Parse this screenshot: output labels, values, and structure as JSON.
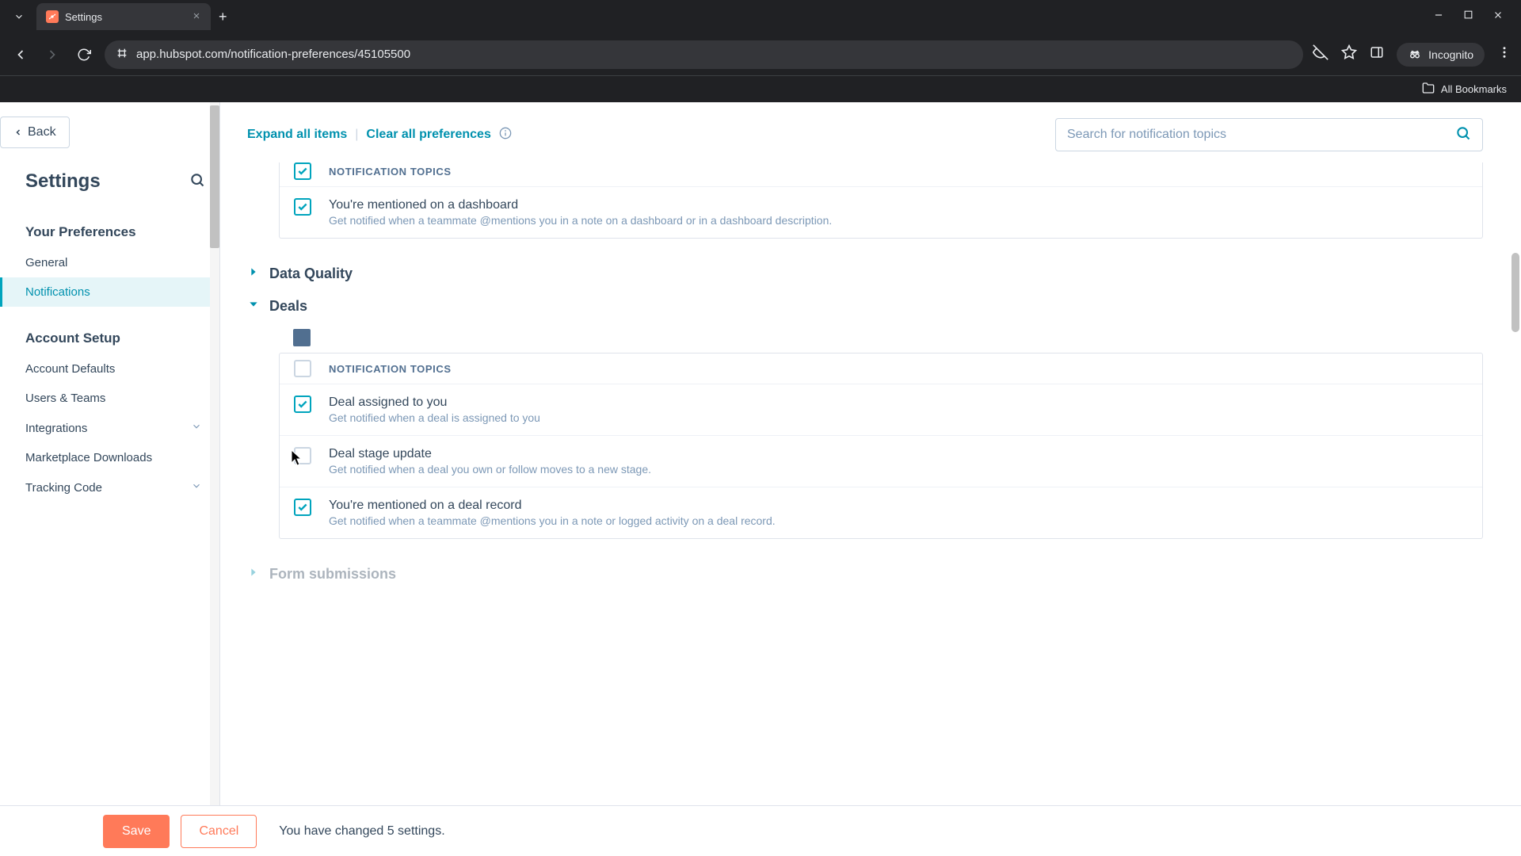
{
  "browser": {
    "tab_title": "Settings",
    "url": "app.hubspot.com/notification-preferences/45105500",
    "incognito_label": "Incognito",
    "bookmarks_label": "All Bookmarks"
  },
  "sidebar": {
    "back_label": "Back",
    "title": "Settings",
    "sections": [
      {
        "heading": "Your Preferences",
        "items": [
          {
            "label": "General",
            "active": false
          },
          {
            "label": "Notifications",
            "active": true
          }
        ]
      },
      {
        "heading": "Account Setup",
        "items": [
          {
            "label": "Account Defaults"
          },
          {
            "label": "Users & Teams"
          },
          {
            "label": "Integrations",
            "expandable": true
          },
          {
            "label": "Marketplace Downloads"
          },
          {
            "label": "Tracking Code",
            "expandable": true
          }
        ]
      }
    ]
  },
  "main": {
    "expand_label": "Expand all items",
    "clear_label": "Clear all preferences",
    "search_placeholder": "Search for notification topics",
    "topics_header": "NOTIFICATION TOPICS",
    "dashboard_group": {
      "items": [
        {
          "title": "You're mentioned on a dashboard",
          "desc": "Get notified when a teammate @mentions you in a note on a dashboard or in a dashboard description.",
          "checked": true
        }
      ]
    },
    "sections": [
      {
        "title": "Data Quality",
        "expanded": false
      },
      {
        "title": "Deals",
        "expanded": true,
        "items": [
          {
            "title": "Deal assigned to you",
            "desc": "Get notified when a deal is assigned to you",
            "checked": true
          },
          {
            "title": "Deal stage update",
            "desc": "Get notified when a deal you own or follow moves to a new stage.",
            "checked": false
          },
          {
            "title": "You're mentioned on a deal record",
            "desc": "Get notified when a teammate @mentions you in a note or logged activity on a deal record.",
            "checked": true
          }
        ]
      },
      {
        "title": "Form submissions",
        "expanded": false
      }
    ]
  },
  "footer": {
    "save_label": "Save",
    "cancel_label": "Cancel",
    "message": "You have changed 5 settings."
  }
}
